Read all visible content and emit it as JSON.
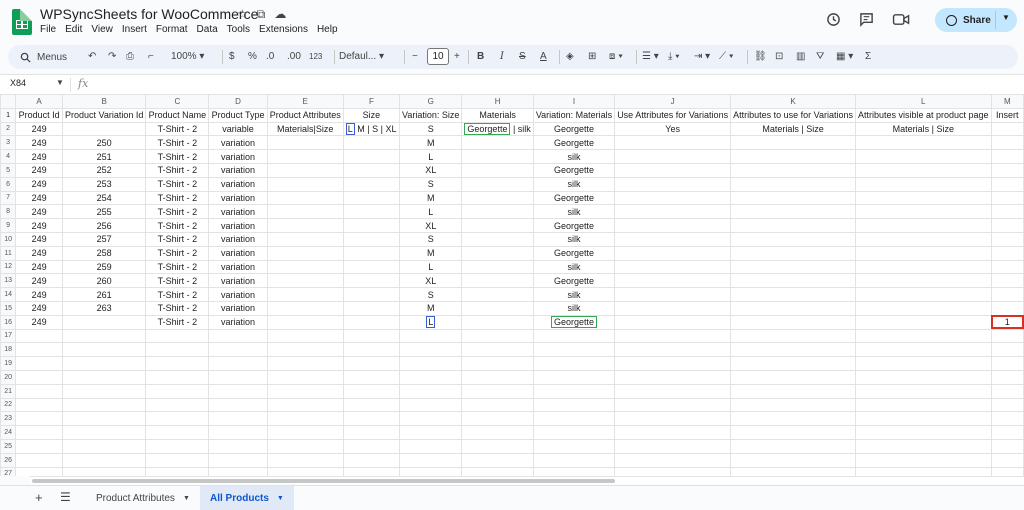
{
  "title": "WPSyncSheets for WooCommerce",
  "title_icons": [
    "☆",
    "⧉",
    "☁"
  ],
  "menu": [
    "File",
    "Edit",
    "View",
    "Insert",
    "Format",
    "Data",
    "Tools",
    "Extensions",
    "Help"
  ],
  "right_icons": [
    "history-icon",
    "comment-icon",
    "meet-icon"
  ],
  "share_label": "Share",
  "toolbar": {
    "search_label": "Menus",
    "zoom": "100%",
    "currency": "$",
    "percent": "%",
    "dec_decrease": ".0",
    "dec_increase": ".00",
    "number_format": "123",
    "font": "Defaul...",
    "font_size": "10"
  },
  "formula": {
    "cell_ref": "X84",
    "fx": "fx",
    "value": ""
  },
  "columns": [
    "A",
    "B",
    "C",
    "D",
    "E",
    "F",
    "G",
    "H",
    "I",
    "J",
    "K",
    "L",
    "M"
  ],
  "headers": [
    "Product Id",
    "Product Variation Id",
    "Product Name",
    "Product Type",
    "Product Attributes",
    "Size",
    "Variation: Size",
    "Materials",
    "Variation: Materials",
    "Use Attributes for Variations",
    "Attributes to use for Variations",
    "Attributes visible at product page",
    "Insert"
  ],
  "row2": {
    "id": "249",
    "name": "T-Shirt - 2",
    "type": "variable",
    "attrs": "Materials|Size",
    "size_chip": "L",
    "size_rest": "M | S | XL",
    "var_size": "S",
    "materials_chip": "Georgette",
    "materials_rest": "| silk",
    "var_materials": "Georgette",
    "use_attr": "Yes",
    "attr_var": "Materials | Size",
    "attr_visible": "Materials | Size"
  },
  "rows": [
    {
      "id": "249",
      "vid": "250",
      "name": "T-Shirt - 2",
      "type": "variation",
      "size": "M",
      "mat": "Georgette"
    },
    {
      "id": "249",
      "vid": "251",
      "name": "T-Shirt - 2",
      "type": "variation",
      "size": "L",
      "mat": "silk"
    },
    {
      "id": "249",
      "vid": "252",
      "name": "T-Shirt - 2",
      "type": "variation",
      "size": "XL",
      "mat": "Georgette"
    },
    {
      "id": "249",
      "vid": "253",
      "name": "T-Shirt - 2",
      "type": "variation",
      "size": "S",
      "mat": "silk"
    },
    {
      "id": "249",
      "vid": "254",
      "name": "T-Shirt - 2",
      "type": "variation",
      "size": "M",
      "mat": "Georgette"
    },
    {
      "id": "249",
      "vid": "255",
      "name": "T-Shirt - 2",
      "type": "variation",
      "size": "L",
      "mat": "silk"
    },
    {
      "id": "249",
      "vid": "256",
      "name": "T-Shirt - 2",
      "type": "variation",
      "size": "XL",
      "mat": "Georgette"
    },
    {
      "id": "249",
      "vid": "257",
      "name": "T-Shirt - 2",
      "type": "variation",
      "size": "S",
      "mat": "silk"
    },
    {
      "id": "249",
      "vid": "258",
      "name": "T-Shirt - 2",
      "type": "variation",
      "size": "M",
      "mat": "Georgette"
    },
    {
      "id": "249",
      "vid": "259",
      "name": "T-Shirt - 2",
      "type": "variation",
      "size": "L",
      "mat": "silk"
    },
    {
      "id": "249",
      "vid": "260",
      "name": "T-Shirt - 2",
      "type": "variation",
      "size": "XL",
      "mat": "Georgette"
    },
    {
      "id": "249",
      "vid": "261",
      "name": "T-Shirt - 2",
      "type": "variation",
      "size": "S",
      "mat": "silk"
    },
    {
      "id": "249",
      "vid": "263",
      "name": "T-Shirt - 2",
      "type": "variation",
      "size": "M",
      "mat": "silk"
    }
  ],
  "row16": {
    "id": "249",
    "name": "T-Shirt - 2",
    "type": "variation",
    "size_chip": "L",
    "mat_chip": "Georgette",
    "insert": "1"
  },
  "empty_rows": [
    "17",
    "18",
    "19",
    "20",
    "21",
    "22",
    "23",
    "24",
    "25",
    "26",
    "27"
  ],
  "tabs": [
    "Product Attributes",
    "All Products"
  ],
  "colors": {
    "accent": "#0b57d0",
    "share_bg": "#c2e7ff",
    "sheets_green": "#0f9d58",
    "highlight_red": "#d93025",
    "highlight_green": "#34a853",
    "highlight_blue": "#3b5bdb"
  }
}
